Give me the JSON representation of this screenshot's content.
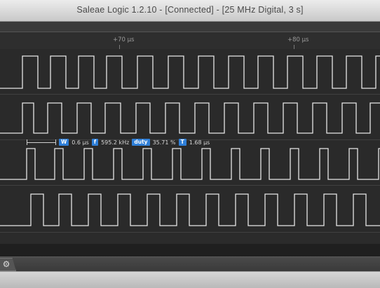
{
  "window": {
    "title": "Saleae Logic 1.2.10 - [Connected] - [25 MHz Digital, 3 s]"
  },
  "ruler": {
    "ticks": [
      "+70 µs",
      "+80 µs"
    ]
  },
  "measurement": {
    "width_badge": "W",
    "width_value": "0.6 µs",
    "freq_badge": "f",
    "freq_value": "595.2 kHz",
    "duty_badge": "duty",
    "duty_value": "35.71 %",
    "period_badge": "T",
    "period_value": "1.68 µs"
  },
  "icons": {
    "settings": "gear-icon"
  },
  "colors": {
    "trace": "#e6e6e6",
    "background": "#2a2a2a",
    "badge": "#2f7fd8"
  }
}
